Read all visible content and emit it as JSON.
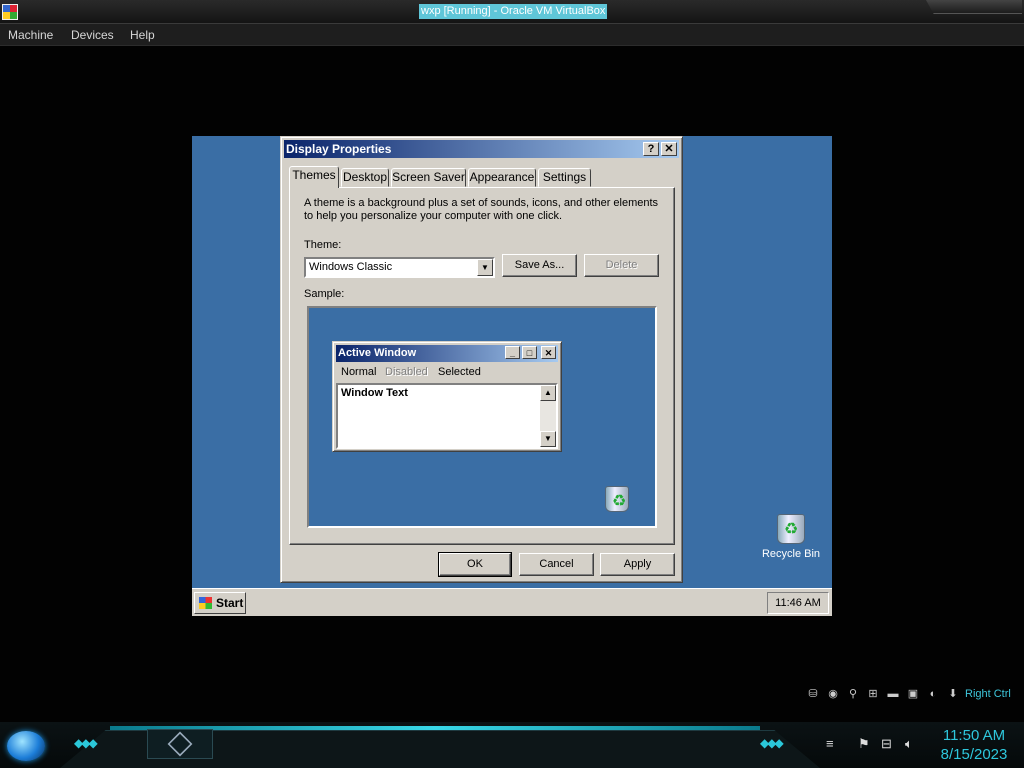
{
  "host": {
    "title": "wxp [Running] - Oracle VM VirtualBox",
    "menu": [
      "Machine",
      "Devices",
      "Help"
    ],
    "right_ctrl": "Right Ctrl",
    "time": "11:50 AM",
    "date": "8/15/2023"
  },
  "guest": {
    "start_label": "Start",
    "clock": "11:46 AM",
    "recycle_bin_label": "Recycle Bin"
  },
  "dialog": {
    "title": "Display Properties",
    "help_glyph": "?",
    "close_glyph": "✕",
    "tabs": [
      "Themes",
      "Desktop",
      "Screen Saver",
      "Appearance",
      "Settings"
    ],
    "active_tab": "Themes",
    "description": "A theme is a background plus a set of sounds, icons, and other elements to help you personalize your computer with one click.",
    "theme_label": "Theme:",
    "theme_value": "Windows Classic",
    "save_as_label": "Save As...",
    "delete_label": "Delete",
    "sample_label": "Sample:",
    "ok_label": "OK",
    "cancel_label": "Cancel",
    "apply_label": "Apply"
  },
  "sample_window": {
    "title": "Active Window",
    "menu_normal": "Normal",
    "menu_disabled": "Disabled",
    "menu_selected": "Selected",
    "window_text": "Window Text"
  },
  "colors": {
    "guest_desktop": "#3a6ea5",
    "dialog_face": "#d4d0c8",
    "titlebar_start": "#0a246a",
    "titlebar_end": "#a6caf0",
    "host_accent": "#2ec7dc"
  }
}
